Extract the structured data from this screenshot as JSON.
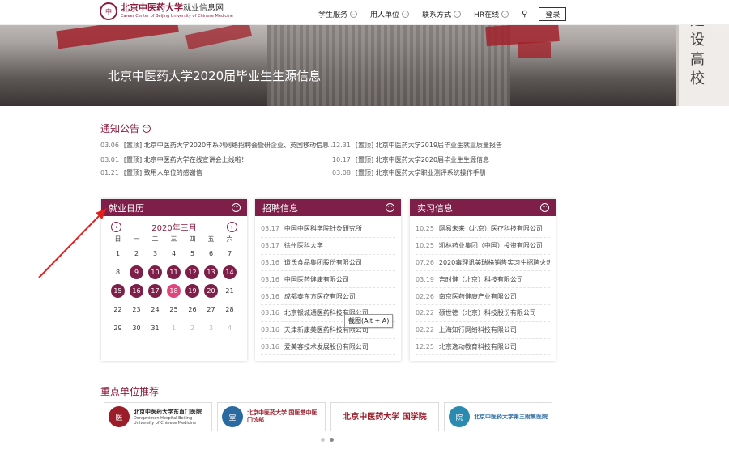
{
  "header": {
    "logo_title": "北京中医药大学",
    "logo_site": "就业信息网",
    "logo_sub": "Career Center of Beijing University of Chinese Medicine",
    "nav": [
      "学生服务",
      "用人单位",
      "联系方式",
      "HR在线"
    ],
    "login_label": "登录"
  },
  "banner": {
    "title": "北京中医药大学2020届毕业生生源信息",
    "side_text": "建设高校"
  },
  "notices": {
    "heading": "通知公告",
    "items": [
      {
        "date": "03.06",
        "text": "[置顶] 北京中医药大学2020年系列网络招聘会暨研企业、英国移动信息..."
      },
      {
        "date": "12.31",
        "text": "[置顶] 北京中医药大学2019届毕业生就业质量报告"
      },
      {
        "date": "03.01",
        "text": "[置顶] 北京中医药大学在线宣讲会上线啦！"
      },
      {
        "date": "10.17",
        "text": "[置顶] 北京中医药大学2020届毕业生生源信息"
      },
      {
        "date": "01.21",
        "text": "[置顶] 致用人单位的感谢信"
      },
      {
        "date": "03.08",
        "text": "[置顶] 北京中医药大学职业测评系统操作手册"
      }
    ]
  },
  "calendar": {
    "heading": "就业日历",
    "month": "2020年三月",
    "weekdays": [
      "日",
      "一",
      "二",
      "三",
      "四",
      "五",
      "六"
    ],
    "days": [
      {
        "d": "1",
        "s": ""
      },
      {
        "d": "2",
        "s": ""
      },
      {
        "d": "3",
        "s": ""
      },
      {
        "d": "4",
        "s": ""
      },
      {
        "d": "5",
        "s": ""
      },
      {
        "d": "6",
        "s": ""
      },
      {
        "d": "7",
        "s": ""
      },
      {
        "d": "8",
        "s": ""
      },
      {
        "d": "9",
        "s": "ev"
      },
      {
        "d": "10",
        "s": "ev"
      },
      {
        "d": "11",
        "s": "ev"
      },
      {
        "d": "12",
        "s": "ev"
      },
      {
        "d": "13",
        "s": "ev"
      },
      {
        "d": "14",
        "s": "ev"
      },
      {
        "d": "15",
        "s": "ev"
      },
      {
        "d": "16",
        "s": "ev"
      },
      {
        "d": "17",
        "s": "ev"
      },
      {
        "d": "18",
        "s": "today"
      },
      {
        "d": "19",
        "s": "ev"
      },
      {
        "d": "20",
        "s": "ev"
      },
      {
        "d": "21",
        "s": ""
      },
      {
        "d": "22",
        "s": ""
      },
      {
        "d": "23",
        "s": ""
      },
      {
        "d": "24",
        "s": ""
      },
      {
        "d": "25",
        "s": ""
      },
      {
        "d": "26",
        "s": ""
      },
      {
        "d": "27",
        "s": ""
      },
      {
        "d": "28",
        "s": ""
      },
      {
        "d": "29",
        "s": ""
      },
      {
        "d": "30",
        "s": ""
      },
      {
        "d": "31",
        "s": ""
      },
      {
        "d": "1",
        "s": "other"
      },
      {
        "d": "2",
        "s": "other"
      },
      {
        "d": "3",
        "s": "other"
      },
      {
        "d": "4",
        "s": "other"
      }
    ]
  },
  "recruit": {
    "heading": "招聘信息",
    "items": [
      {
        "date": "03.17",
        "text": "中国中医科学院针灸研究所"
      },
      {
        "date": "03.17",
        "text": "徐州医科大学"
      },
      {
        "date": "03.16",
        "text": "道氏食品集团股份有限公司"
      },
      {
        "date": "03.16",
        "text": "中国医药健康有限公司"
      },
      {
        "date": "03.16",
        "text": "成都泰东方医疗有限公司"
      },
      {
        "date": "03.16",
        "text": "北京银城通医药科技有限公司"
      },
      {
        "date": "03.16",
        "text": "天津新康美医药科技有限公司"
      },
      {
        "date": "03.16",
        "text": "爱美客技术发展股份有限公司"
      }
    ]
  },
  "intern": {
    "heading": "实习信息",
    "items": [
      {
        "date": "10.25",
        "text": "网易未来（北京）医疗科技有限公司"
      },
      {
        "date": "10.25",
        "text": "凯林药业集团（中国）投资有限公司"
      },
      {
        "date": "07.26",
        "text": "2020毒理讯美瑞格销售实习生招聘火热..."
      },
      {
        "date": "03.19",
        "text": "吉时健（北京）科技有限公司"
      },
      {
        "date": "02.26",
        "text": "南京医药健康产业有限公司"
      },
      {
        "date": "02.22",
        "text": "硕世德（北京）科技股份有限公司"
      },
      {
        "date": "02.22",
        "text": "上海知行网络科技有限公司"
      },
      {
        "date": "12.25",
        "text": "北京逸动教育科技有限公司"
      }
    ]
  },
  "tooltip": "截图(Alt + A)",
  "recommended": {
    "heading": "重点单位推荐",
    "items": [
      {
        "name": "北京中医药大学东直门医院",
        "sub": "Dongzhimen Hospital Beijing University of Chinese Medicine",
        "color": "#9b1d2a"
      },
      {
        "name": "北京中医药大学 国医堂中医门诊部",
        "sub": "",
        "color": "#2a6aa0"
      },
      {
        "name": "北京中医药大学 国学院",
        "sub": "",
        "color": "#9b1d2a"
      },
      {
        "name": "北京中医药大学第三附属医院",
        "sub": "",
        "color": "#2a8ab0"
      }
    ]
  }
}
